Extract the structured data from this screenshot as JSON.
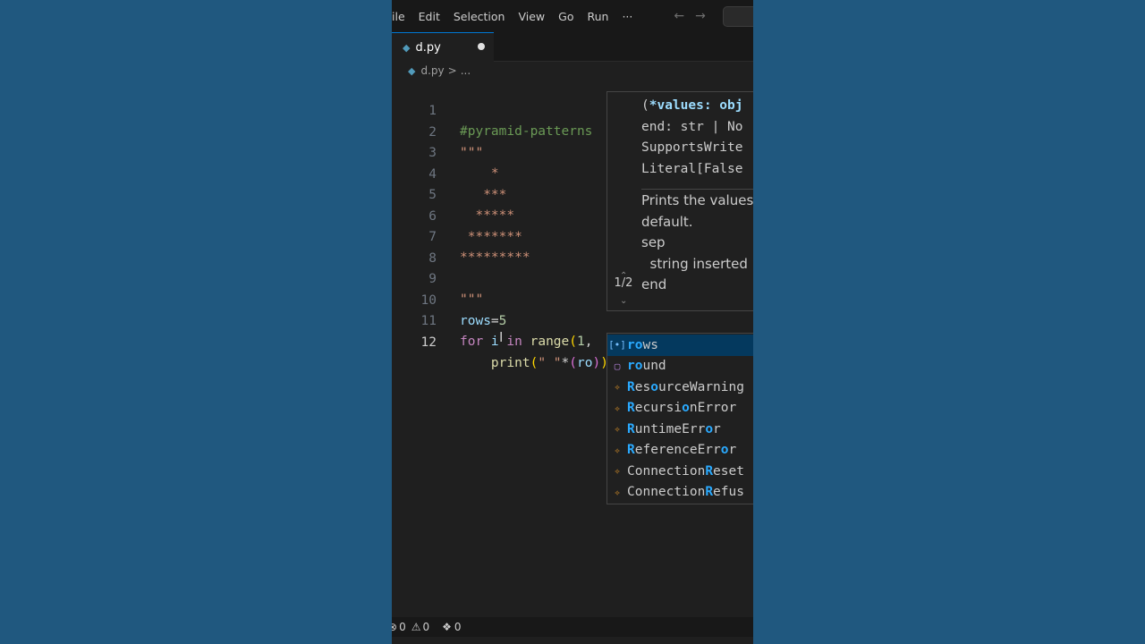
{
  "menu": {
    "items": [
      "ile",
      "Edit",
      "Selection",
      "View",
      "Go",
      "Run",
      "···"
    ],
    "back_icon": "←",
    "forward_icon": "→"
  },
  "tab": {
    "filename": "d.py",
    "icon": "python-icon"
  },
  "breadcrumb": {
    "file": "d.py",
    "separator": ">",
    "rest": "..."
  },
  "code": {
    "line_numbers": [
      "1",
      "2",
      "3",
      "4",
      "5",
      "6",
      "7",
      "8",
      "9",
      "10",
      "11",
      "12"
    ],
    "l1": "#pyramid-patterns",
    "l2": "\"\"\"",
    "l3": "    *",
    "l4": "   ***",
    "l5": "  *****",
    "l6": " *******",
    "l7": "*********",
    "l9": "\"\"\"",
    "l10_var": "rows",
    "l10_eq": "=",
    "l10_num": "5",
    "l11_kw1": "for",
    "l11_var": " i ",
    "l11_kw2": "in",
    "l11_fn": " range",
    "l11_open": "(",
    "l11_num": "1",
    "l11_comma": ",",
    "l12_indent": "    ",
    "l12_fn": "print",
    "l12_open": "(",
    "l12_str": "\" \"",
    "l12_op": "*",
    "l12_paren": "(",
    "l12_typed": "ro",
    "l12_close": ")",
    "l12_close2": ")"
  },
  "hover": {
    "sig_l1_paren": "(",
    "sig_l1_param": "*values: obj",
    "sig_l2": "end: str | No",
    "sig_l3": "SupportsWrite",
    "sig_l4": "Literal[False",
    "doc_l1": "Prints the values",
    "doc_l2": "default.",
    "doc_l3": "sep",
    "doc_l4": "  string inserted",
    "doc_l5": "end",
    "counter": "1/2"
  },
  "suggestions": [
    {
      "match": "ro",
      "rest": "ws",
      "kind": "variable"
    },
    {
      "match": "ro",
      "rest": "und",
      "kind": "function"
    },
    {
      "prefix": "",
      "match": "R",
      "mid": "es",
      "match2": "o",
      "rest": "urceWarning",
      "kind": "class"
    },
    {
      "prefix": "",
      "match": "R",
      "mid": "ecursi",
      "match2": "o",
      "rest": "nError",
      "kind": "class"
    },
    {
      "prefix": "",
      "match": "R",
      "mid": "untimeErr",
      "match2": "o",
      "rest": "r",
      "kind": "class"
    },
    {
      "prefix": "",
      "match": "R",
      "mid": "eferenceErr",
      "match2": "o",
      "rest": "r",
      "kind": "class"
    },
    {
      "prefix": "Connection",
      "match": "R",
      "mid": "eset",
      "match2": "",
      "rest": "",
      "kind": "class"
    },
    {
      "prefix": "Connection",
      "match": "R",
      "mid": "efus",
      "match2": "",
      "rest": "",
      "kind": "class"
    }
  ],
  "status": {
    "errors": "0",
    "warnings": "0",
    "ports": "0"
  }
}
